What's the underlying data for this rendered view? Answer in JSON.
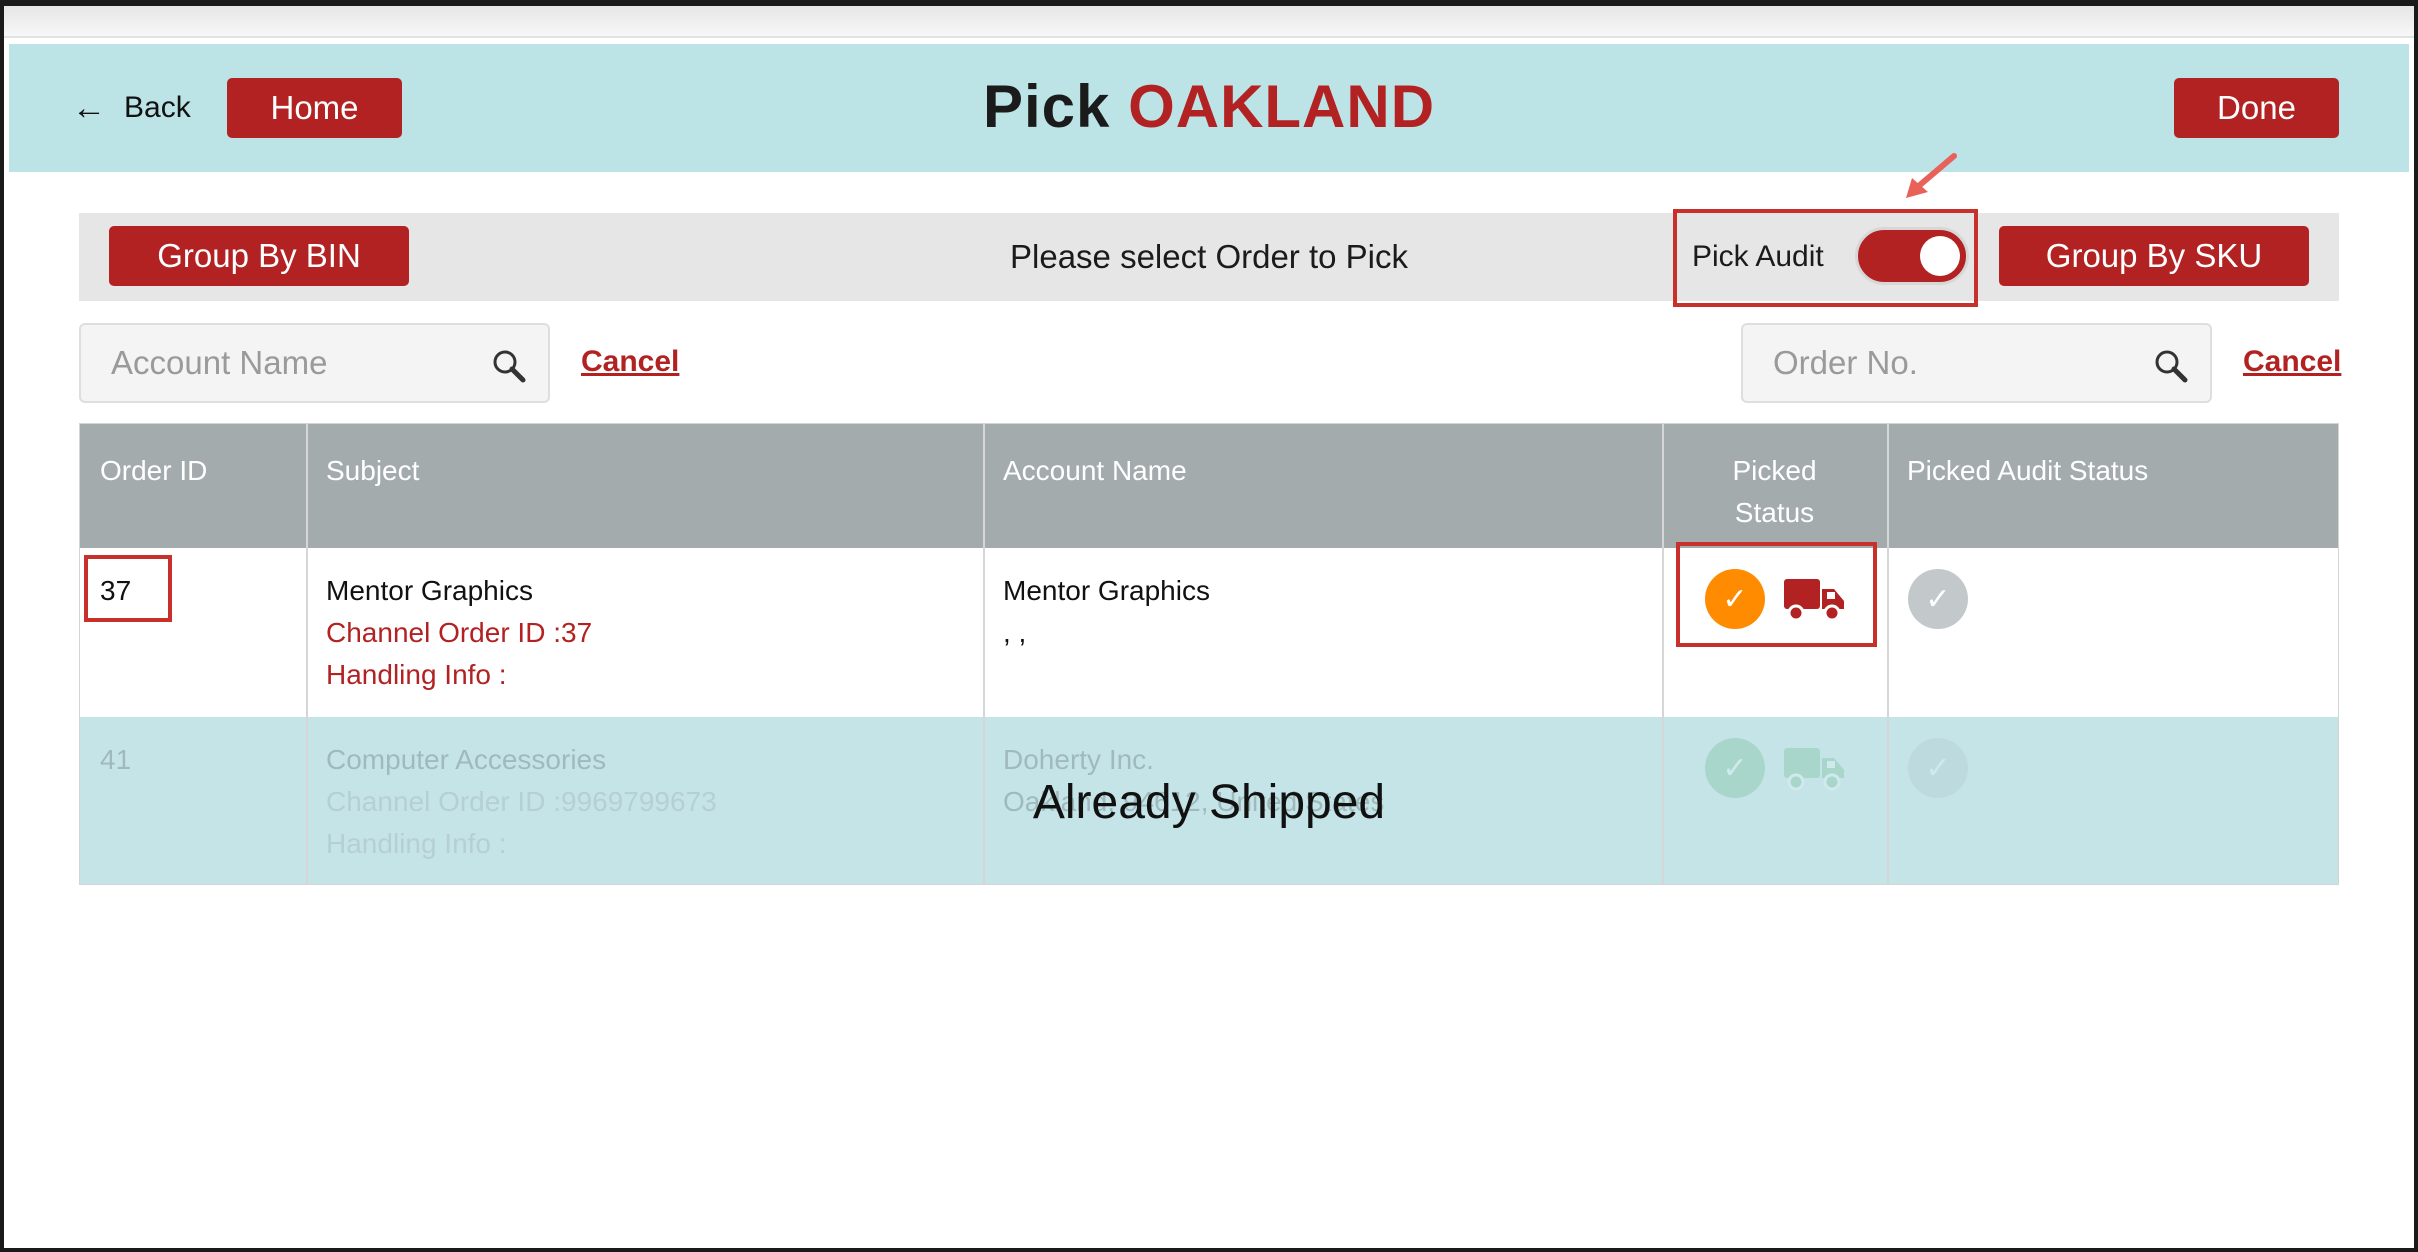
{
  "nav": {
    "back_label": "Back",
    "home_label": "Home",
    "done_label": "Done"
  },
  "title": {
    "prefix": "Pick",
    "location": "OAKLAND"
  },
  "toolbar": {
    "group_bin_label": "Group By BIN",
    "prompt": "Please select Order to Pick",
    "pick_audit_label": "Pick Audit",
    "pick_audit_on": true,
    "group_sku_label": "Group By SKU"
  },
  "search": {
    "account_placeholder": "Account Name",
    "account_cancel": "Cancel",
    "order_placeholder": "Order No.",
    "order_cancel": "Cancel"
  },
  "table": {
    "headers": {
      "order_id": "Order ID",
      "subject": "Subject",
      "account_name": "Account Name",
      "picked_status_line1": "Picked",
      "picked_status_line2": "Status",
      "picked_audit_status": "Picked Audit Status"
    },
    "rows": [
      {
        "order_id": "37",
        "subject": "Mentor Graphics",
        "channel_order": "Channel Order ID :37",
        "handling": "Handling Info :",
        "account": "Mentor Graphics",
        "account_line2": ", ,",
        "picked": "pending",
        "audit": "not-audited"
      },
      {
        "order_id": "41",
        "subject": "Computer Accessories",
        "channel_order": "Channel Order ID :9969799673",
        "handling": "Handling Info :",
        "account": "Doherty Inc.",
        "account_line2": "Oakland, 94612, United States",
        "picked": "picked",
        "audit": "not-audited",
        "overlay": "Already Shipped"
      }
    ]
  },
  "colors": {
    "header_bg": "#bce3e6",
    "brand_red": "#b22222",
    "pending_orange": "#ff8c00",
    "picked_green": "#3aa35a",
    "audit_gray": "#c3c8cb",
    "shipped_row_bg": "#c5e4e8",
    "table_header_bg": "#a3abad"
  },
  "icons": {
    "back": "left-arrow-icon",
    "search": "magnifier-icon",
    "picked": "checkmark-circle-icon",
    "shipping": "truck-icon"
  }
}
